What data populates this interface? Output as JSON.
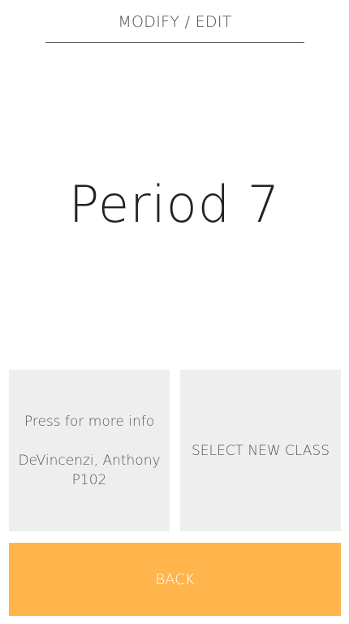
{
  "header": {
    "title": "MODIFY / EDIT"
  },
  "period": {
    "label": "Period 7"
  },
  "info_card": {
    "prompt": "Press for more info",
    "teacher": "DeVincenzi, Anthony",
    "room": "P102"
  },
  "select_card": {
    "label": "SELECT NEW CLASS"
  },
  "back_button": {
    "label": "BACK"
  },
  "colors": {
    "accent": "#ffb54c",
    "card_background": "#eeeeee",
    "text": "#4a4a4a"
  }
}
